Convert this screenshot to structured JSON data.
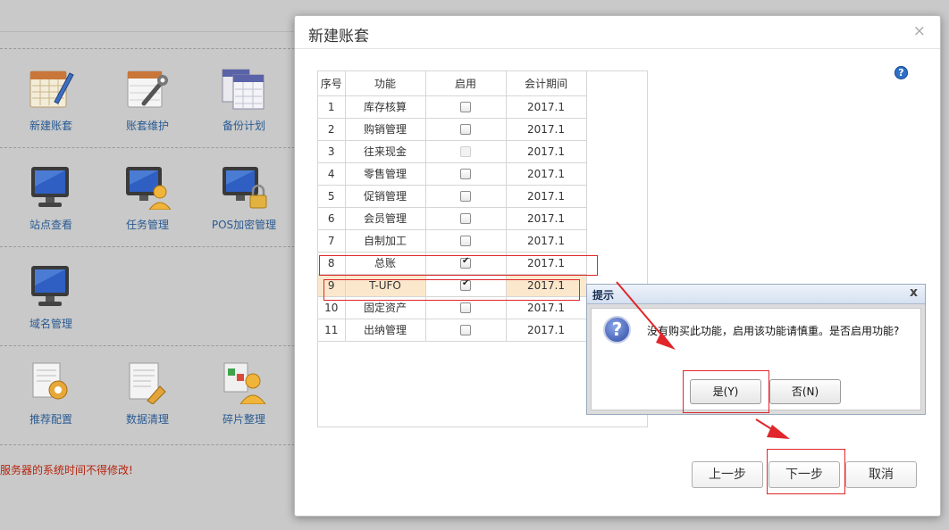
{
  "background": {
    "tools": [
      {
        "label": "新建账套",
        "icon": "ledger-calendar-icon"
      },
      {
        "label": "账套维护",
        "icon": "ledger-wrench-icon"
      },
      {
        "label": "备份计划",
        "icon": "backup-calendar-icon"
      },
      {
        "label": "站点查看",
        "icon": "monitor-icon"
      },
      {
        "label": "任务管理",
        "icon": "monitor-user-icon"
      },
      {
        "label": "POS加密管理",
        "icon": "monitor-lock-icon"
      },
      {
        "label": "域名管理",
        "icon": "monitor-icon"
      },
      {
        "label": "推荐配置",
        "icon": "document-gear-icon"
      },
      {
        "label": "数据清理",
        "icon": "document-edit-icon"
      },
      {
        "label": "碎片整理",
        "icon": "user-puzzle-icon"
      }
    ],
    "warning": "服务器的系统时间不得修改!"
  },
  "dialog": {
    "title": "新建账套",
    "columns": [
      "序号",
      "功能",
      "启用",
      "会计期间"
    ],
    "rows": [
      {
        "no": "1",
        "name": "库存核算",
        "enabled": false,
        "disabled": false,
        "period": "2017.1"
      },
      {
        "no": "2",
        "name": "购销管理",
        "enabled": false,
        "disabled": false,
        "period": "2017.1"
      },
      {
        "no": "3",
        "name": "往来现金",
        "enabled": false,
        "disabled": true,
        "period": "2017.1"
      },
      {
        "no": "4",
        "name": "零售管理",
        "enabled": false,
        "disabled": false,
        "period": "2017.1"
      },
      {
        "no": "5",
        "name": "促销管理",
        "enabled": false,
        "disabled": false,
        "period": "2017.1"
      },
      {
        "no": "6",
        "name": "会员管理",
        "enabled": false,
        "disabled": false,
        "period": "2017.1"
      },
      {
        "no": "7",
        "name": "自制加工",
        "enabled": false,
        "disabled": false,
        "period": "2017.1"
      },
      {
        "no": "8",
        "name": "总账",
        "enabled": true,
        "disabled": false,
        "period": "2017.1"
      },
      {
        "no": "9",
        "name": "T-UFO",
        "enabled": true,
        "disabled": false,
        "period": "2017.1",
        "highlighted": true
      },
      {
        "no": "10",
        "name": "固定资产",
        "enabled": false,
        "disabled": false,
        "period": "2017.1"
      },
      {
        "no": "11",
        "name": "出纳管理",
        "enabled": false,
        "disabled": false,
        "period": "2017.1"
      }
    ],
    "buttons": {
      "prev": "上一步",
      "next": "下一步",
      "cancel": "取消"
    },
    "help": "?",
    "close": "×"
  },
  "popup": {
    "title": "提示",
    "close": "x",
    "message": "没有购买此功能，启用该功能请慎重。是否启用功能?",
    "yes": "是(Y)",
    "no": "否(N)"
  },
  "annotation_color": "#e0262a"
}
